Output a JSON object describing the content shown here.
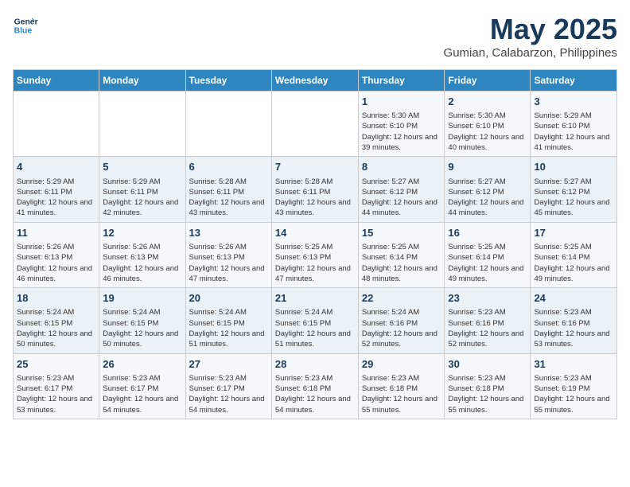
{
  "logo": {
    "line1": "General",
    "line2": "Blue"
  },
  "title": "May 2025",
  "subtitle": "Gumian, Calabarzon, Philippines",
  "weekdays": [
    "Sunday",
    "Monday",
    "Tuesday",
    "Wednesday",
    "Thursday",
    "Friday",
    "Saturday"
  ],
  "weeks": [
    [
      {
        "day": "",
        "info": ""
      },
      {
        "day": "",
        "info": ""
      },
      {
        "day": "",
        "info": ""
      },
      {
        "day": "",
        "info": ""
      },
      {
        "day": "1",
        "info": "Sunrise: 5:30 AM\nSunset: 6:10 PM\nDaylight: 12 hours and 39 minutes."
      },
      {
        "day": "2",
        "info": "Sunrise: 5:30 AM\nSunset: 6:10 PM\nDaylight: 12 hours and 40 minutes."
      },
      {
        "day": "3",
        "info": "Sunrise: 5:29 AM\nSunset: 6:10 PM\nDaylight: 12 hours and 41 minutes."
      }
    ],
    [
      {
        "day": "4",
        "info": "Sunrise: 5:29 AM\nSunset: 6:11 PM\nDaylight: 12 hours and 41 minutes."
      },
      {
        "day": "5",
        "info": "Sunrise: 5:29 AM\nSunset: 6:11 PM\nDaylight: 12 hours and 42 minutes."
      },
      {
        "day": "6",
        "info": "Sunrise: 5:28 AM\nSunset: 6:11 PM\nDaylight: 12 hours and 43 minutes."
      },
      {
        "day": "7",
        "info": "Sunrise: 5:28 AM\nSunset: 6:11 PM\nDaylight: 12 hours and 43 minutes."
      },
      {
        "day": "8",
        "info": "Sunrise: 5:27 AM\nSunset: 6:12 PM\nDaylight: 12 hours and 44 minutes."
      },
      {
        "day": "9",
        "info": "Sunrise: 5:27 AM\nSunset: 6:12 PM\nDaylight: 12 hours and 44 minutes."
      },
      {
        "day": "10",
        "info": "Sunrise: 5:27 AM\nSunset: 6:12 PM\nDaylight: 12 hours and 45 minutes."
      }
    ],
    [
      {
        "day": "11",
        "info": "Sunrise: 5:26 AM\nSunset: 6:13 PM\nDaylight: 12 hours and 46 minutes."
      },
      {
        "day": "12",
        "info": "Sunrise: 5:26 AM\nSunset: 6:13 PM\nDaylight: 12 hours and 46 minutes."
      },
      {
        "day": "13",
        "info": "Sunrise: 5:26 AM\nSunset: 6:13 PM\nDaylight: 12 hours and 47 minutes."
      },
      {
        "day": "14",
        "info": "Sunrise: 5:25 AM\nSunset: 6:13 PM\nDaylight: 12 hours and 47 minutes."
      },
      {
        "day": "15",
        "info": "Sunrise: 5:25 AM\nSunset: 6:14 PM\nDaylight: 12 hours and 48 minutes."
      },
      {
        "day": "16",
        "info": "Sunrise: 5:25 AM\nSunset: 6:14 PM\nDaylight: 12 hours and 49 minutes."
      },
      {
        "day": "17",
        "info": "Sunrise: 5:25 AM\nSunset: 6:14 PM\nDaylight: 12 hours and 49 minutes."
      }
    ],
    [
      {
        "day": "18",
        "info": "Sunrise: 5:24 AM\nSunset: 6:15 PM\nDaylight: 12 hours and 50 minutes."
      },
      {
        "day": "19",
        "info": "Sunrise: 5:24 AM\nSunset: 6:15 PM\nDaylight: 12 hours and 50 minutes."
      },
      {
        "day": "20",
        "info": "Sunrise: 5:24 AM\nSunset: 6:15 PM\nDaylight: 12 hours and 51 minutes."
      },
      {
        "day": "21",
        "info": "Sunrise: 5:24 AM\nSunset: 6:15 PM\nDaylight: 12 hours and 51 minutes."
      },
      {
        "day": "22",
        "info": "Sunrise: 5:24 AM\nSunset: 6:16 PM\nDaylight: 12 hours and 52 minutes."
      },
      {
        "day": "23",
        "info": "Sunrise: 5:23 AM\nSunset: 6:16 PM\nDaylight: 12 hours and 52 minutes."
      },
      {
        "day": "24",
        "info": "Sunrise: 5:23 AM\nSunset: 6:16 PM\nDaylight: 12 hours and 53 minutes."
      }
    ],
    [
      {
        "day": "25",
        "info": "Sunrise: 5:23 AM\nSunset: 6:17 PM\nDaylight: 12 hours and 53 minutes."
      },
      {
        "day": "26",
        "info": "Sunrise: 5:23 AM\nSunset: 6:17 PM\nDaylight: 12 hours and 54 minutes."
      },
      {
        "day": "27",
        "info": "Sunrise: 5:23 AM\nSunset: 6:17 PM\nDaylight: 12 hours and 54 minutes."
      },
      {
        "day": "28",
        "info": "Sunrise: 5:23 AM\nSunset: 6:18 PM\nDaylight: 12 hours and 54 minutes."
      },
      {
        "day": "29",
        "info": "Sunrise: 5:23 AM\nSunset: 6:18 PM\nDaylight: 12 hours and 55 minutes."
      },
      {
        "day": "30",
        "info": "Sunrise: 5:23 AM\nSunset: 6:18 PM\nDaylight: 12 hours and 55 minutes."
      },
      {
        "day": "31",
        "info": "Sunrise: 5:23 AM\nSunset: 6:19 PM\nDaylight: 12 hours and 55 minutes."
      }
    ]
  ]
}
